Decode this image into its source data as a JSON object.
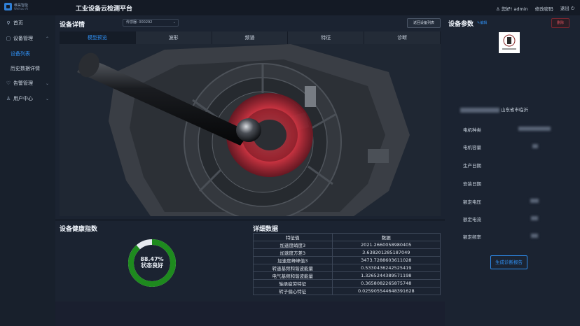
{
  "header": {
    "logo_line1": "维昊智能",
    "logo_line2": "Weihao AI",
    "app_title": "工业设备云检测平台",
    "user_greeting": "您好! admin",
    "change_password": "修改密码",
    "logout": "退出"
  },
  "sidebar": {
    "items": [
      {
        "label": "首页",
        "icon": "location-pin-icon"
      },
      {
        "label": "设备管理",
        "icon": "folder-icon",
        "expanded": true
      },
      {
        "label": "告警管理",
        "icon": "bell-icon"
      },
      {
        "label": "用户中心",
        "icon": "user-icon"
      }
    ],
    "sub_items": [
      {
        "label": "设备列表",
        "active": true
      },
      {
        "label": "历史数据详情",
        "active": false
      }
    ]
  },
  "device_detail": {
    "title": "设备详情",
    "sensor_select": "传感器: 000292",
    "return_button": "返回设备列表",
    "tabs": [
      {
        "label": "模型预览",
        "active": true
      },
      {
        "label": "波形",
        "active": false
      },
      {
        "label": "频谱",
        "active": false
      },
      {
        "label": "特征",
        "active": false
      },
      {
        "label": "诊断",
        "active": false
      }
    ]
  },
  "device_params": {
    "title": "设备参数",
    "edit_label": "编辑",
    "delete_label": "删除",
    "location_suffix": "山东省市临沂",
    "fields": [
      {
        "label": "电机种类"
      },
      {
        "label": "电机容量"
      },
      {
        "label": "生产日期"
      },
      {
        "label": "安装日期"
      },
      {
        "label": "额定电压"
      },
      {
        "label": "额定电流"
      },
      {
        "label": "额定频率"
      }
    ],
    "report_button": "生成诊断报告"
  },
  "health": {
    "title": "设备健康指数",
    "percent_text": "88.47%",
    "percent_value": 0.8847,
    "status_text": "状态良好",
    "color": "#1e8a1e",
    "track_color": "#e6eaf0"
  },
  "details": {
    "title": "详细数据",
    "columns": [
      "特征值",
      "数据"
    ],
    "rows": [
      [
        "加速度峭度3",
        "2021.2660058980405"
      ],
      [
        "加速度方差3",
        "3.638201285187049"
      ],
      [
        "加速度峰峰值3",
        "3473.7288603611028"
      ],
      [
        "转速基频和谐波能量",
        "0.5330436242525419"
      ],
      [
        "电气基频和谐波能量",
        "1.3265244389571198"
      ],
      [
        "轴承疲劳特征",
        "0.3658082265875748"
      ],
      [
        "转子偏心特征",
        "0.025905544648391628"
      ]
    ]
  }
}
